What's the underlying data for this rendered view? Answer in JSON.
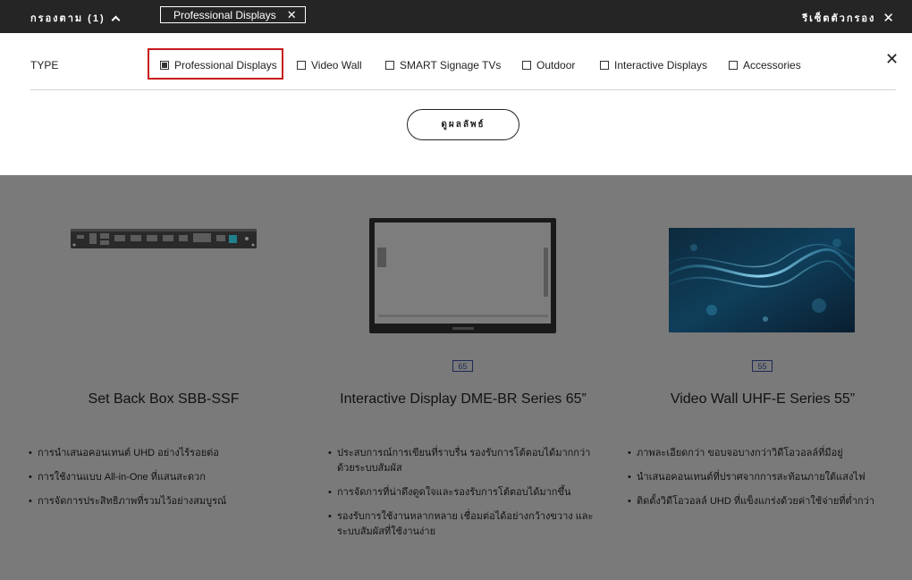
{
  "topbar": {
    "filter_label": "กรองตาม (1)",
    "chip_label": "Professional Displays",
    "reset_label": "รีเซ็ตตัวกรอง"
  },
  "panel": {
    "type_label": "TYPE",
    "options": [
      {
        "label": "Professional Displays",
        "checked": true
      },
      {
        "label": "Video Wall",
        "checked": false
      },
      {
        "label": "SMART Signage TVs",
        "checked": false
      },
      {
        "label": "Outdoor",
        "checked": false
      },
      {
        "label": "Interactive Displays",
        "checked": false
      },
      {
        "label": "Accessories",
        "checked": false
      }
    ],
    "results_button": "ดูผลลัพธ์"
  },
  "products": [
    {
      "title": "Set Back Box SBB-SSF",
      "size": "",
      "features": [
        "การนำเสนอคอนเทนต์ UHD อย่างไร้รอยต่อ",
        "การใช้งานแบบ All-in-One ที่แสนสะดวก",
        "การจัดการประสิทธิภาพที่รวมไว้อย่างสมบูรณ์"
      ]
    },
    {
      "title": "Interactive Display DME-BR Series 65”",
      "size": "65",
      "features": [
        "ประสบการณ์การเขียนที่ราบรื่น รองรับการโต้ตอบได้มากกว่าด้วยระบบสัมผัส",
        "การจัดการที่น่าดึงดูดใจและรองรับการโต้ตอบได้มากขึ้น",
        "รองรับการใช้งานหลากหลาย เชื่อมต่อได้อย่างกว้างขวาง และระบบสัมผัสที่ใช้งานง่าย"
      ]
    },
    {
      "title": "Video Wall UHF-E Series 55”",
      "size": "55",
      "features": [
        "ภาพละเอียดกว่า ขอบจอบางกว่าวิดีโอวอลล์ที่มีอยู่",
        "นำเสนอคอนเทนต์ที่ปราศจากการสะท้อนภายใต้แสงไฟ",
        "ติดตั้งวิดีโอวอลล์ UHD ที่แข็งแกร่งด้วยค่าใช้จ่ายที่ต่ำกว่า"
      ]
    }
  ],
  "colors": {
    "topbar": "#252525",
    "highlight": "#c8171e",
    "overlay": "#7a7a7a",
    "badge": "#1c2a55"
  }
}
